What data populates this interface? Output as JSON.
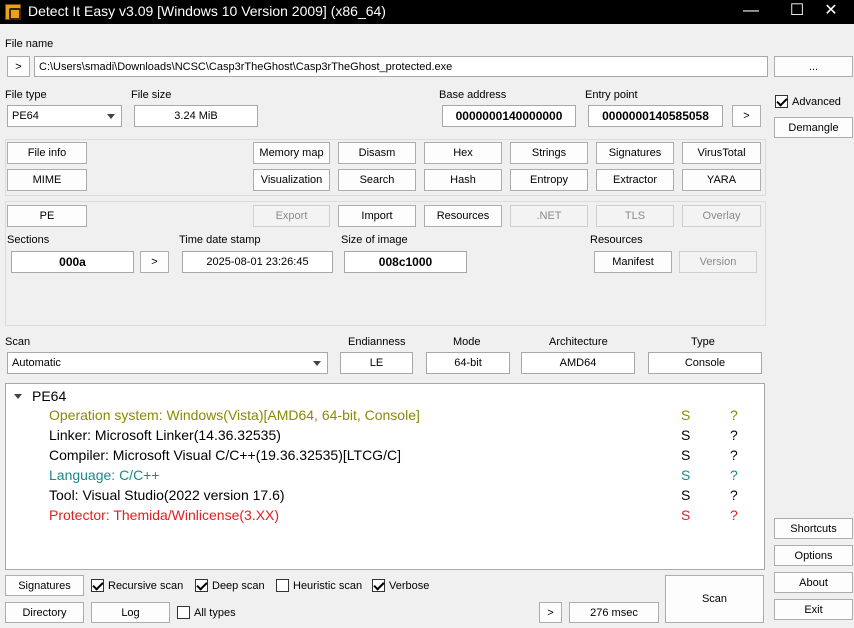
{
  "window": {
    "title": "Detect It Easy v3.09 [Windows 10 Version 2009] (x86_64)",
    "minimize": "—",
    "maximize": "☐",
    "close": "✕"
  },
  "file": {
    "label": "File name",
    "arrow_btn": ">",
    "path": "C:\\Users\\smadi\\Downloads\\NCSC\\Casp3rTheGhost\\Casp3rTheGhost_protected.exe",
    "browse_btn": "..."
  },
  "filetype": {
    "label": "File type",
    "value": "PE64"
  },
  "filesize": {
    "label": "File size",
    "value": "3.24 MiB"
  },
  "base": {
    "label": "Base address",
    "value": "0000000140000000"
  },
  "entry": {
    "label": "Entry point",
    "value": "0000000140585058",
    "btn": ">"
  },
  "side": {
    "advanced_label": "Advanced",
    "advanced_checked": true,
    "demangle": "Demangle",
    "shortcuts": "Shortcuts",
    "options": "Options",
    "about": "About",
    "exit": "Exit"
  },
  "tools": {
    "file_info": "File info",
    "mime": "MIME",
    "memory_map": "Memory map",
    "visualization": "Visualization",
    "disasm": "Disasm",
    "search": "Search",
    "hex": "Hex",
    "hash": "Hash",
    "strings": "Strings",
    "entropy": "Entropy",
    "signatures": "Signatures",
    "extractor": "Extractor",
    "virustotal": "VirusTotal",
    "yara": "YARA"
  },
  "pe": {
    "pe": "PE",
    "export": "Export",
    "import": "Import",
    "resources": "Resources",
    "net": ".NET",
    "tls": "TLS",
    "overlay": "Overlay",
    "sections_label": "Sections",
    "sections_value": "000a",
    "sections_btn": ">",
    "timestamp_label": "Time date stamp",
    "timestamp_value": "2025-08-01 23:26:45",
    "image_size_label": "Size of image",
    "image_size_value": "008c1000",
    "resources_label": "Resources",
    "manifest": "Manifest",
    "version": "Version"
  },
  "scan": {
    "label": "Scan",
    "mode_value": "Automatic",
    "endianness_label": "Endianness",
    "endianness_value": "LE",
    "mode_label": "Mode",
    "bitness_value": "64-bit",
    "arch_label": "Architecture",
    "arch_value": "AMD64",
    "type_label": "Type",
    "type_value": "Console"
  },
  "results": {
    "root": "PE64",
    "rows": [
      {
        "text": "Operation system: Windows(Vista)[AMD64, 64-bit, Console]",
        "s": "S",
        "q": "?",
        "color": "#8a8a00"
      },
      {
        "text": "Linker: Microsoft Linker(14.36.32535)",
        "s": "S",
        "q": "?",
        "color": "#000000"
      },
      {
        "text": "Compiler: Microsoft Visual C/C++(19.36.32535)[LTCG/C]",
        "s": "S",
        "q": "?",
        "color": "#000000"
      },
      {
        "text": "Language: C/C++",
        "s": "S",
        "q": "?",
        "color": "#1a8a8a"
      },
      {
        "text": "Tool: Visual Studio(2022 version 17.6)",
        "s": "S",
        "q": "?",
        "color": "#000000"
      },
      {
        "text": "Protector: Themida/Winlicense(3.XX)",
        "s": "S",
        "q": "?",
        "color": "#e02020"
      }
    ]
  },
  "bottom": {
    "signatures": "Signatures",
    "directory": "Directory",
    "log": "Log",
    "recursive": "Recursive scan",
    "recursive_checked": true,
    "deep": "Deep scan",
    "deep_checked": true,
    "heuristic": "Heuristic scan",
    "heuristic_checked": false,
    "verbose": "Verbose",
    "verbose_checked": true,
    "all_types": "All types",
    "all_types_checked": false,
    "arrow_btn": ">",
    "time": "276 msec",
    "scan": "Scan"
  }
}
